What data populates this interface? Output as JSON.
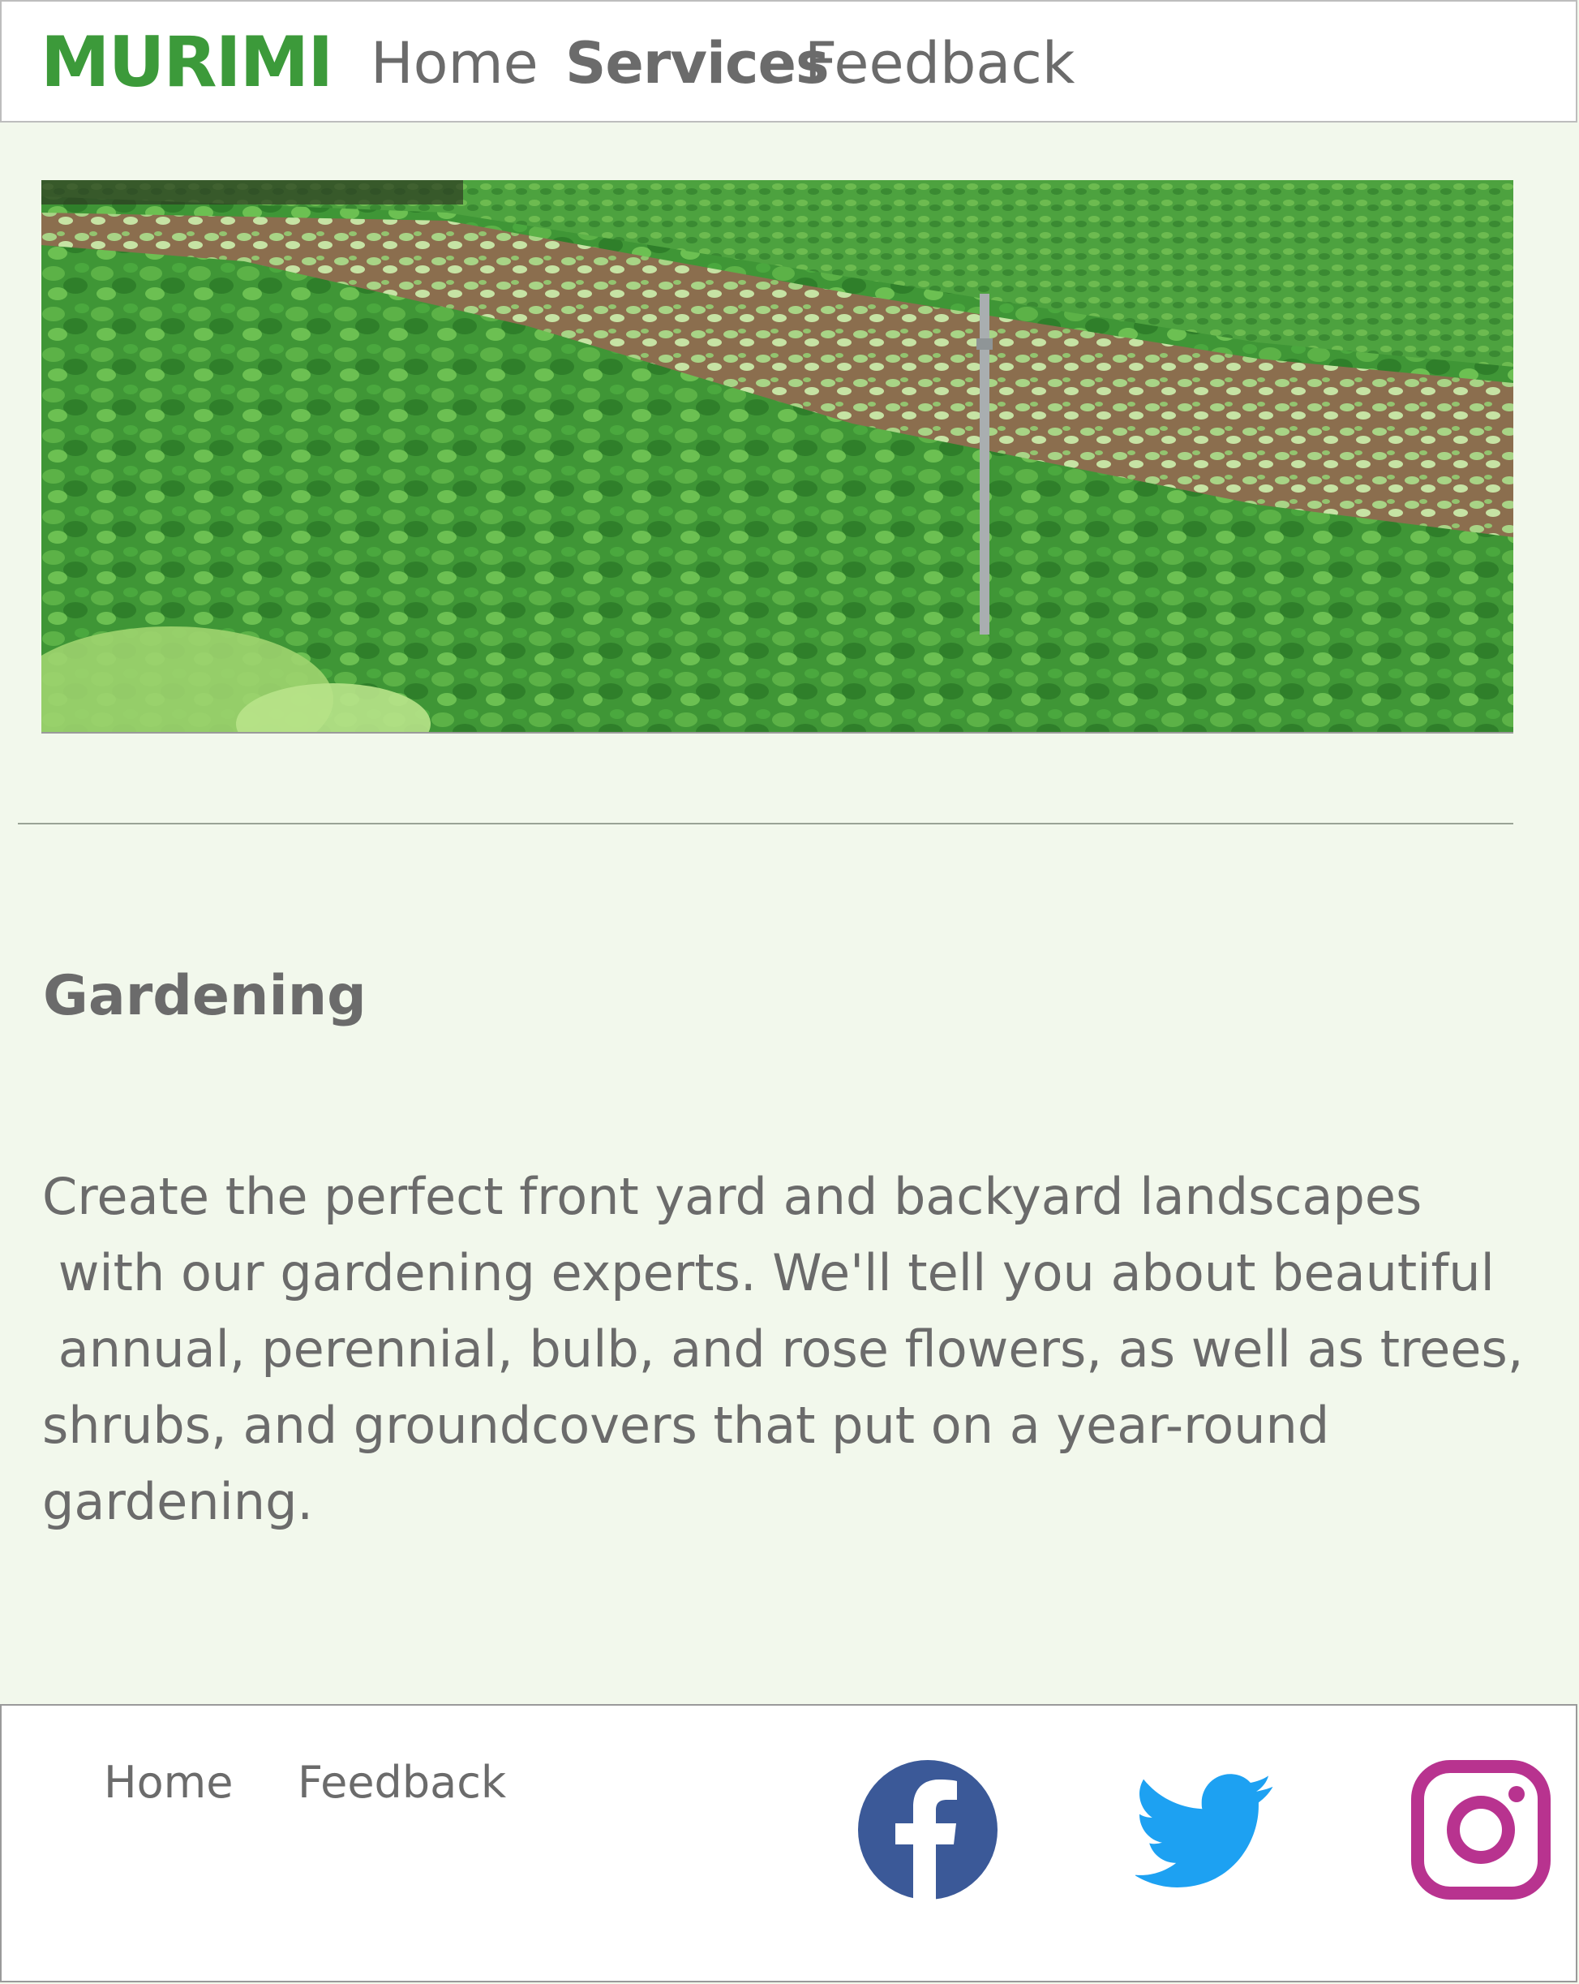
{
  "header": {
    "logo_text": "MURIMI",
    "nav": {
      "home": "Home",
      "services": "Services",
      "feedback": "Feedback"
    }
  },
  "hero": {
    "image_description": "garden-rows-photo"
  },
  "content": {
    "title": "Gardening",
    "description_lines": [
      "Create the perfect front yard and backyard landscapes",
      " with our gardening experts. We'll tell you about beautiful",
      " annual, perennial, bulb, and rose flowers, as well as trees,",
      "shrubs, and groundcovers that put on a year-round",
      "gardening."
    ]
  },
  "footer": {
    "links": {
      "home": "Home",
      "feedback": "Feedback"
    },
    "social": [
      {
        "icon": "facebook-icon",
        "color": "#3b5998"
      },
      {
        "icon": "twitter-icon",
        "color": "#1da1f2"
      },
      {
        "icon": "instagram-icon",
        "color": "#b8338f"
      }
    ]
  },
  "colors": {
    "brand_green": "#3c9a3a",
    "page_bg": "#f2f8ec",
    "text_gray": "#6b6b6b"
  }
}
